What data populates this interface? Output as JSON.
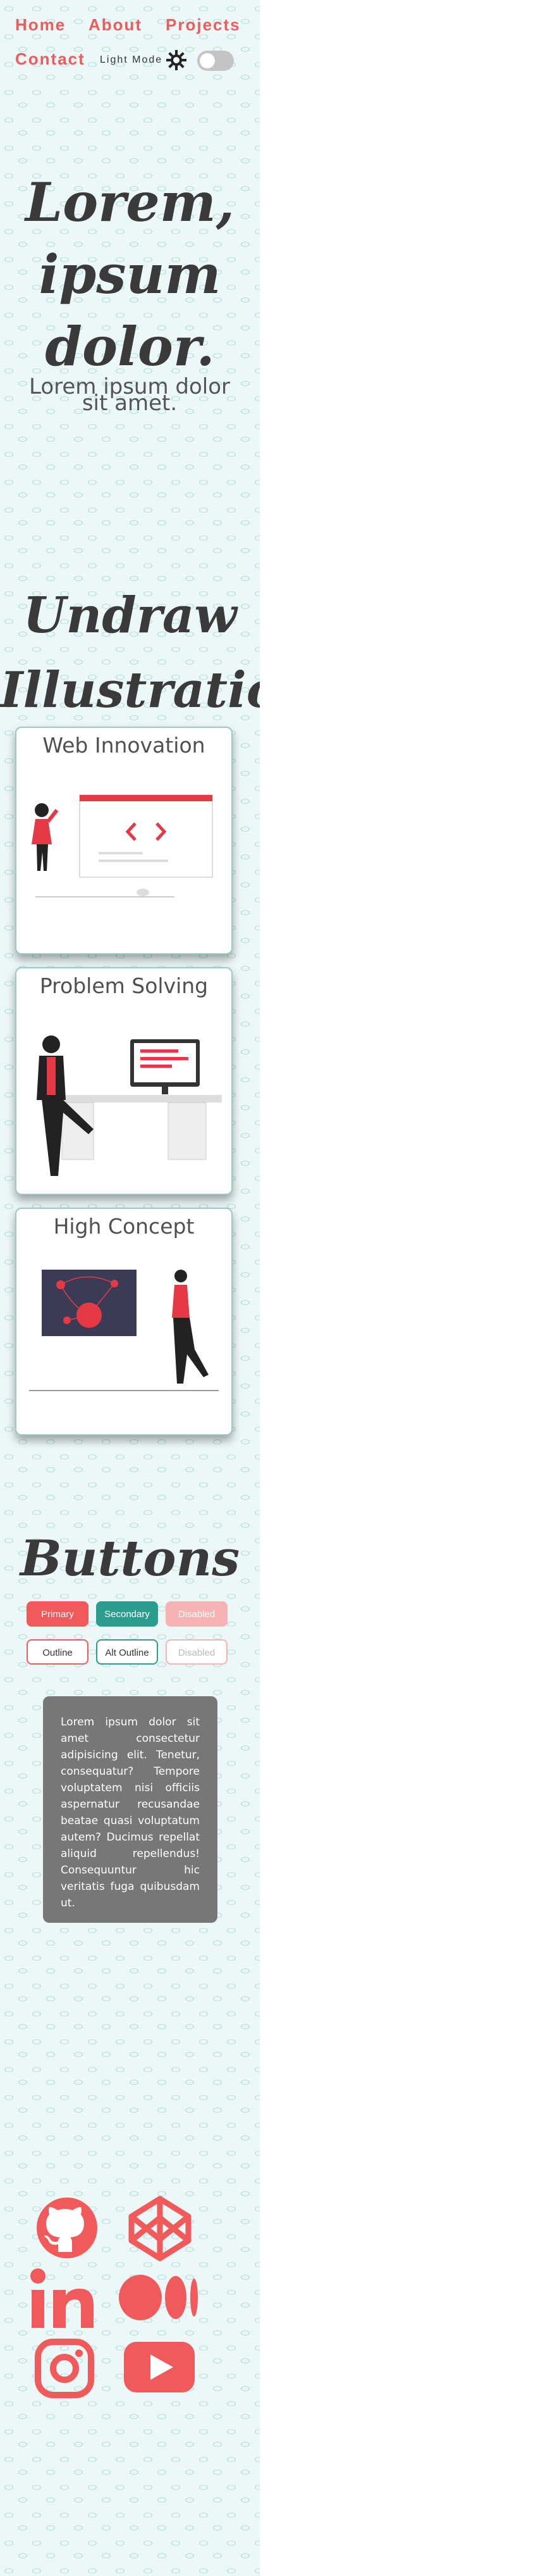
{
  "nav": {
    "home": "Home",
    "about": "About",
    "projects": "Projects",
    "contact": "Contact"
  },
  "theme": {
    "label": "Light Mode",
    "icon": "sun-icon",
    "toggle_on": false
  },
  "hero": {
    "line1": "Lorem,",
    "line2": "ipsum",
    "line3": "dolor.",
    "subtitle": "Lorem ipsum dolor sit amet."
  },
  "illustrations": {
    "heading_line1": "Undraw",
    "heading_line2": "Illustrations",
    "cards": [
      {
        "title": "Web Innovation",
        "image": "web-innovation-illustration"
      },
      {
        "title": "Problem Solving",
        "image": "problem-solving-illustration"
      },
      {
        "title": "High Concept",
        "image": "high-concept-illustration"
      }
    ]
  },
  "buttons": {
    "heading": "Buttons",
    "primary": "Primary",
    "secondary": "Secondary",
    "disabled": "Disabled",
    "outline": "Outline",
    "alt_outline": "Alt Outline",
    "disabled_outline": "Disabled"
  },
  "panel": {
    "text": "Lorem ipsum dolor sit amet consectetur adipisicing elit. Tenetur, consequatur? Tempore voluptatem nisi officiis aspernatur recusandae beatae quasi voluptatum autem? Ducimus repellat aliquid repellendus! Consequuntur hic veritatis fuga quibusdam ut."
  },
  "social": [
    "github-icon",
    "codepen-icon",
    "linkedin-icon",
    "medium-icon",
    "instagram-icon",
    "youtube-icon"
  ],
  "colors": {
    "accent": "#f15a5a",
    "teal": "#2a9d8f",
    "text": "#3a3a3a",
    "panel": "#777777",
    "background_tint": "#ecf7f7"
  }
}
